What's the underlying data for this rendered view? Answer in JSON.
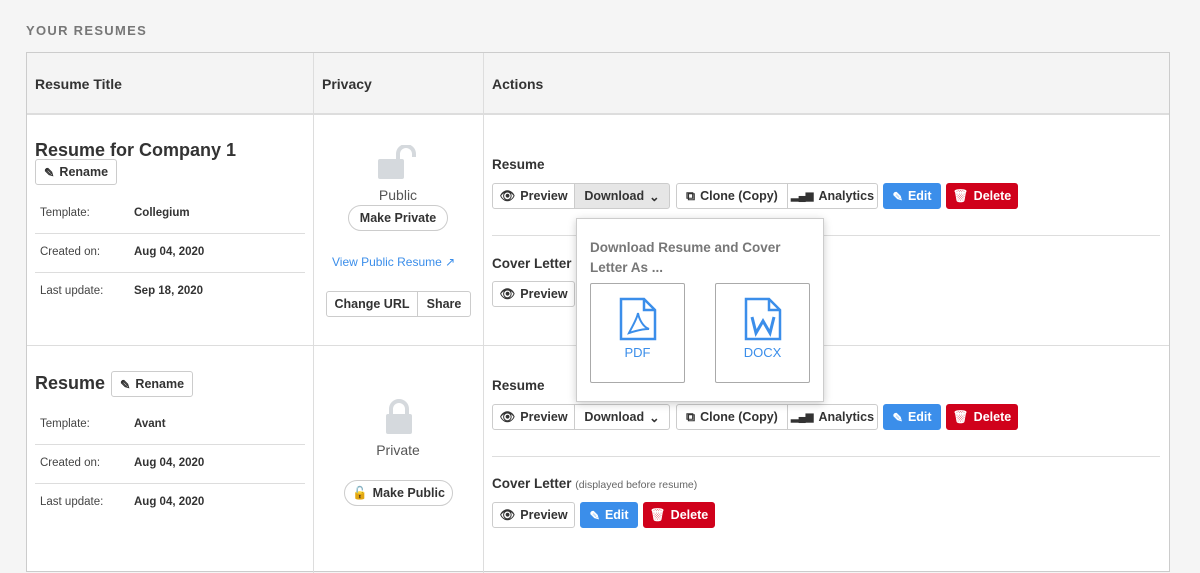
{
  "section_title": "YOUR RESUMES",
  "headers": {
    "title": "Resume Title",
    "privacy": "Privacy",
    "actions": "Actions"
  },
  "buttons": {
    "rename": "Rename",
    "preview": "Preview",
    "download": "Download",
    "clone": "Clone (Copy)",
    "analytics": "Analytics",
    "edit": "Edit",
    "delete": "Delete",
    "make_private": "Make Private",
    "make_public": "Make Public",
    "change_url": "Change URL",
    "share": "Share"
  },
  "labels": {
    "template": "Template:",
    "created": "Created on:",
    "updated": "Last update:",
    "resume": "Resume",
    "cover_letter": "Cover Letter",
    "cover_note": "(displayed before resume)"
  },
  "rows": [
    {
      "title": "Resume for Company 1",
      "template": "Collegium",
      "created": "Aug 04, 2020",
      "updated": "Sep 18, 2020",
      "privacy": "Public",
      "public_link": "View Public Resume"
    },
    {
      "title": "Resume",
      "template": "Avant",
      "created": "Aug 04, 2020",
      "updated": "Aug 04, 2020",
      "privacy": "Private"
    }
  ],
  "popover": {
    "title": "Download Resume and Cover Letter As ...",
    "pdf": "PDF",
    "docx": "DOCX"
  },
  "colors": {
    "blue": "#3b8eea",
    "red": "#d0011b",
    "lock": "#d5d9dd"
  }
}
